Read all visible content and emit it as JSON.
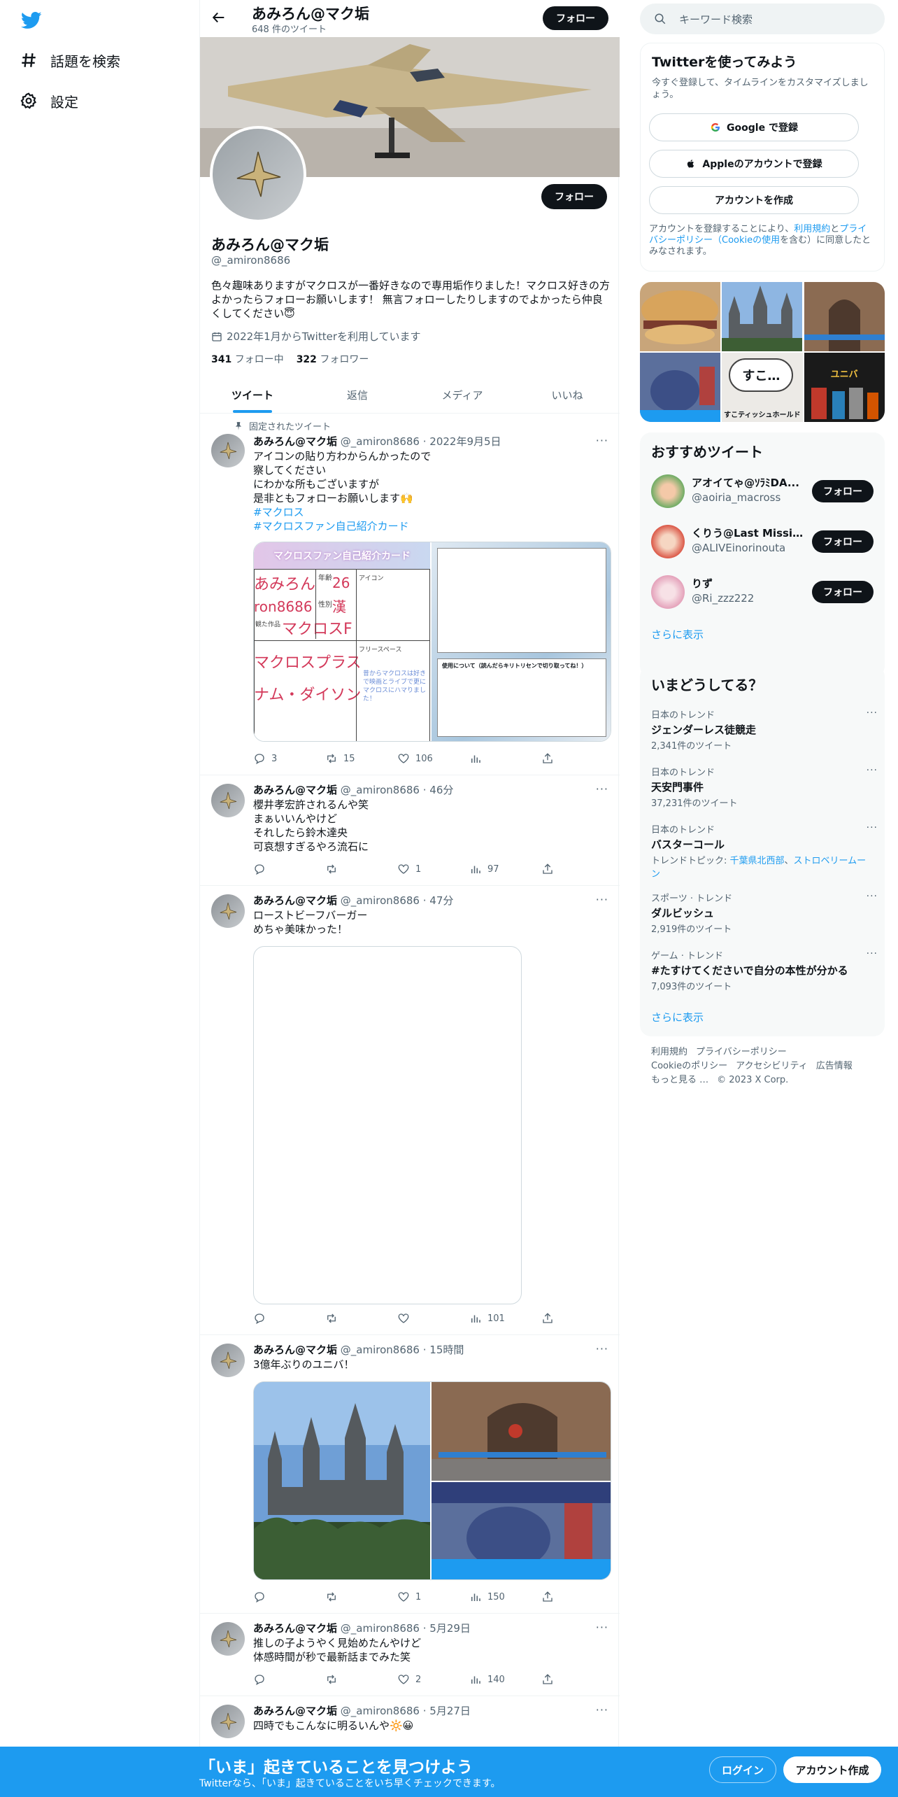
{
  "nav": {
    "explore_label": "話題を検索",
    "settings_label": "設定"
  },
  "header": {
    "name": "あみろん@マク垢",
    "tweet_count": "648 件のツイート",
    "follow_label": "フォロー"
  },
  "profile": {
    "name": "あみろん@マク垢",
    "handle": "@_amiron8686",
    "bio": "色々趣味ありますがマクロスが一番好きなので専用垢作りました！マクロス好きの方よかったらフォローお願いします！ 無言フォローしたりしますのでよかったら仲良くしてください😇",
    "joined": "2022年1月からTwitterを利用しています",
    "following_count": "341",
    "following_label": "フォロー中",
    "followers_count": "322",
    "followers_label": "フォロワー",
    "follow_label": "フォロー"
  },
  "tabs": [
    "ツイート",
    "返信",
    "メディア",
    "いいね"
  ],
  "pinned_label": "固定されたツイート",
  "tweets": [
    {
      "name": "あみろん@マク垢",
      "handle": "@_amiron8686",
      "time": "· 2022年9月5日",
      "lines": [
        "アイコンの貼り方わからんかったので",
        "察してください",
        "にわかな所もございますが",
        "是非ともフォローお願いします🙌"
      ],
      "tags": [
        "#マクロス",
        "#マクロスファン自己紹介カード"
      ],
      "card": {
        "title": "マクロスファン自己紹介カード",
        "name_value": "あみろん",
        "age_value": "26",
        "id_value": "ron8686",
        "gender_value": "漢",
        "work_value": "マクロスF",
        "label_age": "年齢",
        "label_gender": "性別",
        "label_icon": "アイコン",
        "label_work": "観た作品",
        "label_free": "フリースペース",
        "play_value": "マクロスプラス",
        "char_value": "ナム・ダイソン",
        "free_text": "昔からマクロスは好きで映画とライブで更にマクロスにハマりました！",
        "usage_title": "使用について（読んだらキリトリセンで切り取ってね！）"
      },
      "replies": "3",
      "retweets": "15",
      "likes": "106",
      "views": ""
    },
    {
      "name": "あみろん@マク垢",
      "handle": "@_amiron8686",
      "time": "· 46分",
      "lines": [
        "櫻井孝宏許されるんや笑",
        "まぁいいんやけど",
        "それしたら鈴木達央",
        "可哀想すぎるやろ流石に"
      ],
      "replies": "",
      "retweets": "",
      "likes": "1",
      "views": "97"
    },
    {
      "name": "あみろん@マク垢",
      "handle": "@_amiron8686",
      "time": "· 47分",
      "lines": [
        "ローストビーフバーガー",
        "めちゃ美味かった！"
      ],
      "replies": "",
      "retweets": "",
      "likes": "",
      "views": "101"
    },
    {
      "name": "あみろん@マク垢",
      "handle": "@_amiron8686",
      "time": "· 15時間",
      "lines": [
        "3億年ぶりのユニバ！"
      ],
      "replies": "",
      "retweets": "",
      "likes": "1",
      "views": "150"
    },
    {
      "name": "あみろん@マク垢",
      "handle": "@_amiron8686",
      "time": "· 5月29日",
      "lines": [
        "推しの子ようやく見始めたんやけど",
        "体感時間が秒で最新話までみた笑"
      ],
      "replies": "",
      "retweets": "",
      "likes": "2",
      "views": "140"
    },
    {
      "name": "あみろん@マク垢",
      "handle": "@_amiron8686",
      "time": "· 5月27日",
      "lines": [
        "四時でもこんなに明るいんや🔆😀"
      ]
    }
  ],
  "search": {
    "placeholder": "キーワード検索"
  },
  "signup": {
    "title": "Twitterを使ってみよう",
    "subtitle": "今すぐ登録して、タイムラインをカスタマイズしましょう。",
    "google_label": "Google で登録",
    "apple_label": "Appleのアカウントで登録",
    "create_label": "アカウントを作成",
    "note_pre": "アカウントを登録することにより、",
    "note_terms": "利用規約",
    "note_mid": "と",
    "note_privacy": "プライバシーポリシー（Cookieの使用",
    "note_post": "を含む）に同意したとみなされます。"
  },
  "media_grid": {
    "caption_speech": "すこ…",
    "caption_tissue": "すこティッシュホールド",
    "caption_univ": "ユニバ"
  },
  "recommend": {
    "title": "おすすめツイート",
    "users": [
      {
        "name": "アオイてゃ@ｿﾗﾐDA...",
        "handle": "@aoiria_macross"
      },
      {
        "name": "くりう@Last Missio...",
        "handle": "@ALIVEinorinouta"
      },
      {
        "name": "りず",
        "handle": "@Ri_zzz222"
      }
    ],
    "follow_label": "フォロー",
    "more_label": "さらに表示"
  },
  "trends": {
    "title": "いまどうしてる？",
    "items": [
      {
        "category": "日本のトレンド",
        "name": "ジェンダーレス徒競走",
        "count": "2,341件のツイート"
      },
      {
        "category": "日本のトレンド",
        "name": "天安門事件",
        "count": "37,231件のツイート"
      },
      {
        "category": "日本のトレンド",
        "name": "バスターコール",
        "topic_prefix": "トレンドトピック: ",
        "topic_a": "千葉県北西部",
        "topic_sep": "、",
        "topic_b": "ストロベリームーン"
      },
      {
        "category": "スポーツ · トレンド",
        "name": "ダルビッシュ",
        "count": "2,919件のツイート"
      },
      {
        "category": "ゲーム · トレンド",
        "name": "#たすけてくださいで自分の本性が分かる",
        "count": "7,093件のツイート"
      }
    ],
    "more_label": "さらに表示"
  },
  "footer": {
    "links": [
      "利用規約",
      "プライバシーポリシー",
      "Cookieのポリシー",
      "アクセシビリティ",
      "広告情報",
      "もっと見る …",
      "© 2023 X Corp."
    ]
  },
  "bottom_bar": {
    "title": "「いま」起きていることを見つけよう",
    "subtitle": "Twitterなら、「いま」起きていることをいち早くチェックできます。",
    "login_label": "ログイン",
    "signup_label": "アカウント作成"
  },
  "colors": {
    "accent": "#1d9bf0",
    "text": "#0f1419",
    "muted": "#536471",
    "button": "#0f1419"
  }
}
